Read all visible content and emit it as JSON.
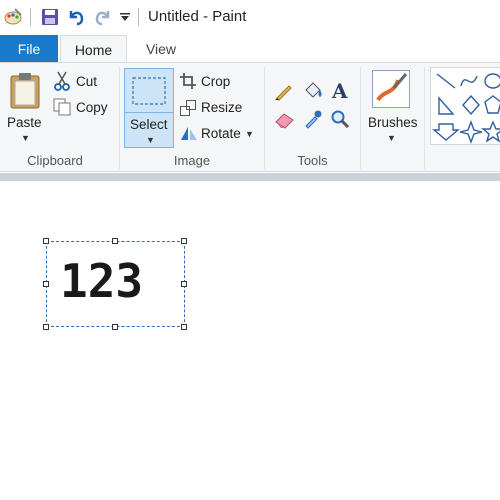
{
  "window": {
    "title": "Untitled - Paint"
  },
  "quick_access": {
    "icons": [
      "paint-app-icon",
      "save-icon",
      "undo-icon",
      "redo-icon",
      "customize-toolbar-icon"
    ]
  },
  "tabs": [
    {
      "label": "File"
    },
    {
      "label": "Home"
    },
    {
      "label": "View"
    }
  ],
  "ribbon": {
    "clipboard": {
      "label": "Clipboard",
      "paste": "Paste",
      "cut": "Cut",
      "copy": "Copy"
    },
    "image": {
      "label": "Image",
      "select": "Select",
      "crop": "Crop",
      "resize": "Resize",
      "rotate": "Rotate"
    },
    "tools": {
      "label": "Tools"
    },
    "brushes": {
      "label": "Brushes"
    }
  },
  "canvas": {
    "text": "123"
  },
  "colors": {
    "file_tab": "#1979ca",
    "ribbon_bg": "#f5f6f7",
    "select_active": "#cde4f7",
    "canvas_strip": "#c8d2dd"
  }
}
